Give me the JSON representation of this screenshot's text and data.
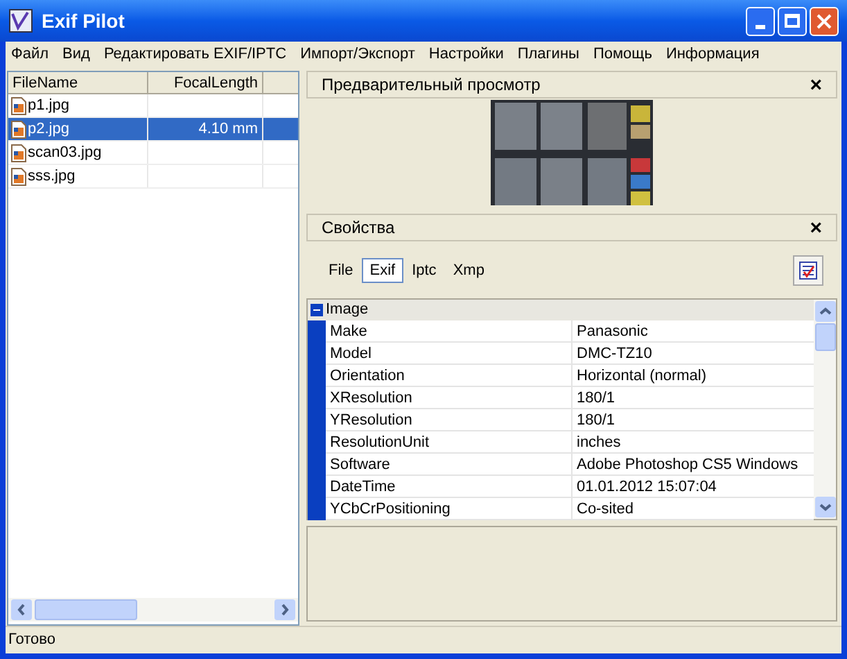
{
  "window": {
    "title": "Exif Pilot"
  },
  "menu": [
    "Файл",
    "Вид",
    "Редактировать EXIF/IPTC",
    "Импорт/Экспорт",
    "Настройки",
    "Плагины",
    "Помощь",
    "Информация"
  ],
  "file_list": {
    "columns": [
      "FileName",
      "FocalLength"
    ],
    "rows": [
      {
        "name": "p1.jpg",
        "focal_length": "",
        "selected": false
      },
      {
        "name": "p2.jpg",
        "focal_length": "4.10 mm",
        "selected": true
      },
      {
        "name": "scan03.jpg",
        "focal_length": "",
        "selected": false
      },
      {
        "name": "sss.jpg",
        "focal_length": "",
        "selected": false
      }
    ]
  },
  "preview": {
    "title": "Предварительный просмотр",
    "close": "×"
  },
  "properties": {
    "title": "Свойства",
    "close": "×",
    "tabs": [
      {
        "label": "File",
        "selected": false
      },
      {
        "label": "Exif",
        "selected": true
      },
      {
        "label": "Iptc",
        "selected": false
      },
      {
        "label": "Xmp",
        "selected": false
      }
    ],
    "groups": [
      {
        "name": "Image",
        "expanded": true,
        "rows": [
          {
            "name": "Make",
            "value": "Panasonic"
          },
          {
            "name": "Model",
            "value": "DMC-TZ10"
          },
          {
            "name": "Orientation",
            "value": "Horizontal (normal)"
          },
          {
            "name": "XResolution",
            "value": "180/1"
          },
          {
            "name": "YResolution",
            "value": "180/1"
          },
          {
            "name": "ResolutionUnit",
            "value": "inches"
          },
          {
            "name": "Software",
            "value": "Adobe Photoshop CS5 Windows"
          },
          {
            "name": "DateTime",
            "value": "01.01.2012 15:07:04"
          },
          {
            "name": "YCbCrPositioning",
            "value": "Co-sited"
          }
        ]
      }
    ]
  },
  "status_bar": "Готово"
}
